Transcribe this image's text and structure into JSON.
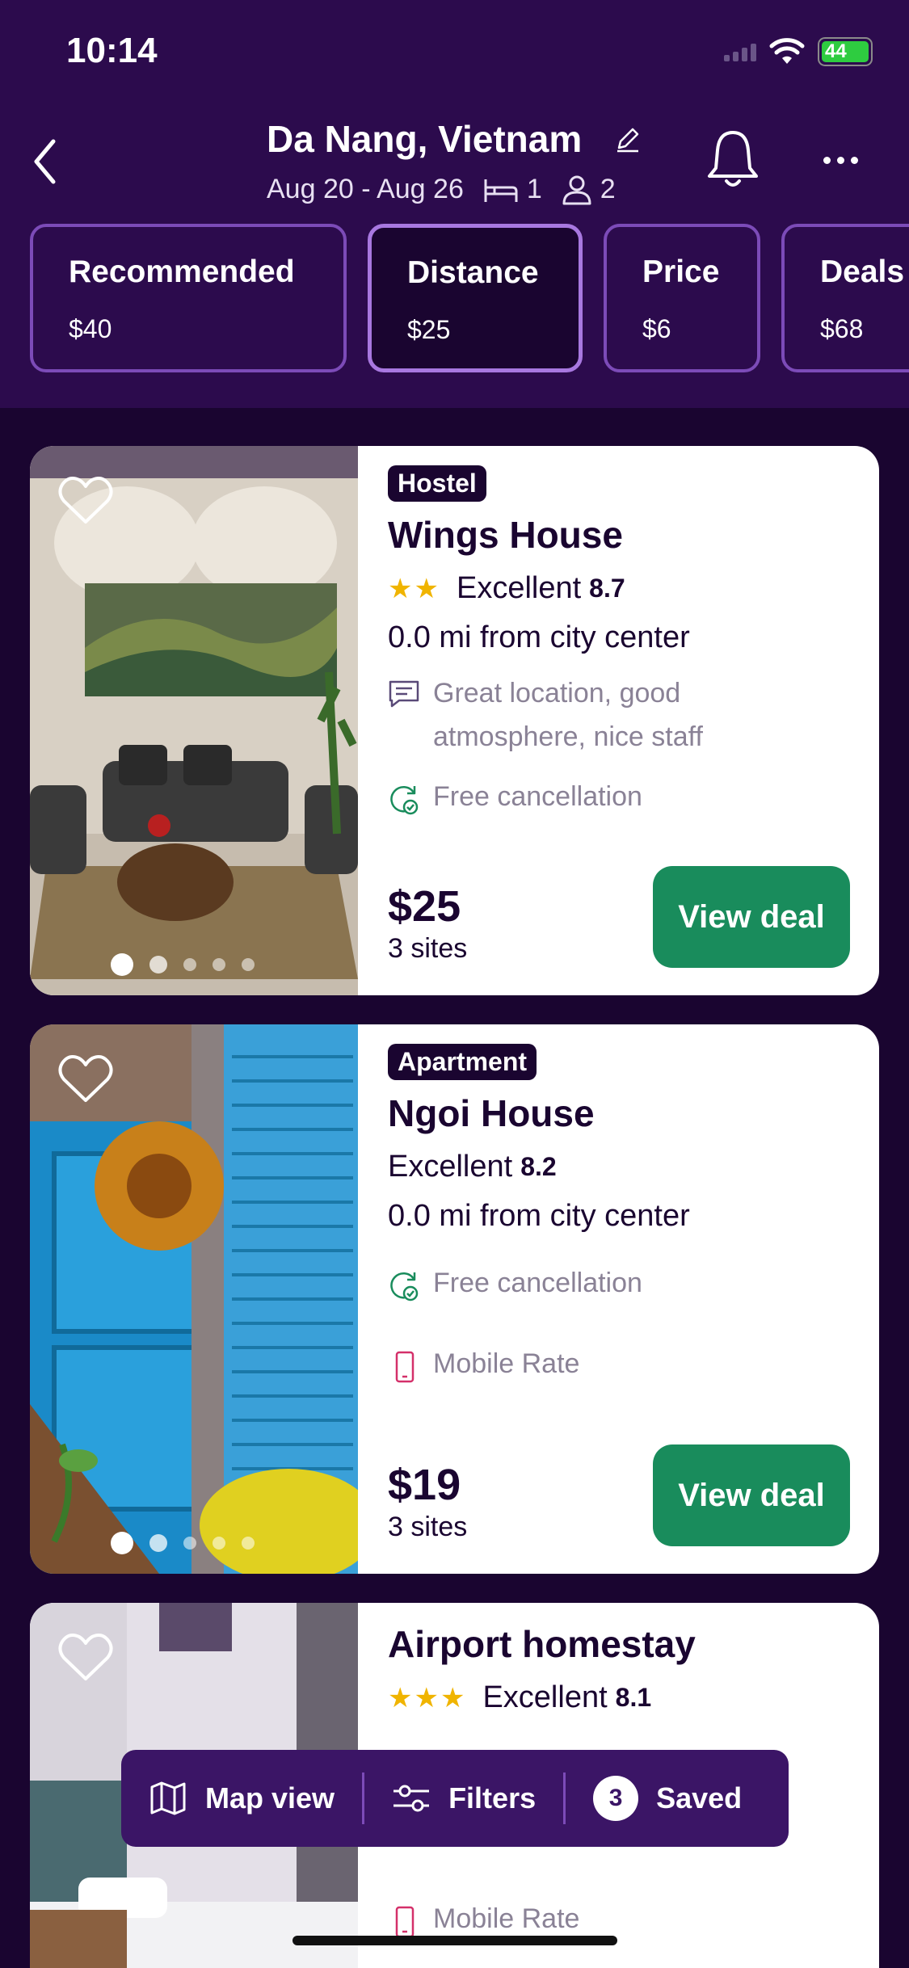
{
  "status_bar": {
    "time": "10:14",
    "battery": "44"
  },
  "header": {
    "title": "Da Nang, Vietnam",
    "dates": "Aug 20 - Aug 26",
    "rooms": "1",
    "guests": "2"
  },
  "sort_tabs": [
    {
      "label": "Recommended",
      "price": "$40"
    },
    {
      "label": "Distance",
      "price": "$25"
    },
    {
      "label": "Price",
      "price": "$6"
    },
    {
      "label": "Deals",
      "price": "$68"
    }
  ],
  "listings": [
    {
      "type": "Hostel",
      "name": "Wings House",
      "stars": "★★",
      "rating_text": "Excellent",
      "rating_score": "8.7",
      "distance": "0.0 mi from city center",
      "review_snippet": "Great location, good atmosphere, nice staff",
      "free_cancellation": "Free cancellation",
      "price": "$25",
      "sites": "3 sites",
      "cta": "View deal"
    },
    {
      "type": "Apartment",
      "name": "Ngoi House",
      "rating_text": "Excellent",
      "rating_score": "8.2",
      "distance": "0.0 mi from city center",
      "free_cancellation": "Free cancellation",
      "mobile_rate": "Mobile Rate",
      "price": "$19",
      "sites": "3 sites",
      "cta": "View deal"
    },
    {
      "name": "Airport homestay",
      "stars": "★★★",
      "rating_text": "Excellent",
      "rating_score": "8.1",
      "mobile_rate": "Mobile Rate"
    }
  ],
  "bottom_bar": {
    "map_label": "Map view",
    "filters_label": "Filters",
    "saved_count": "3",
    "saved_label": "Saved"
  },
  "colors": {
    "header_bg": "#2c0b4d",
    "page_bg": "#1a0530",
    "deal_green": "#198c5c",
    "accent_purple": "#7c4bb8",
    "star": "#f0b400"
  }
}
